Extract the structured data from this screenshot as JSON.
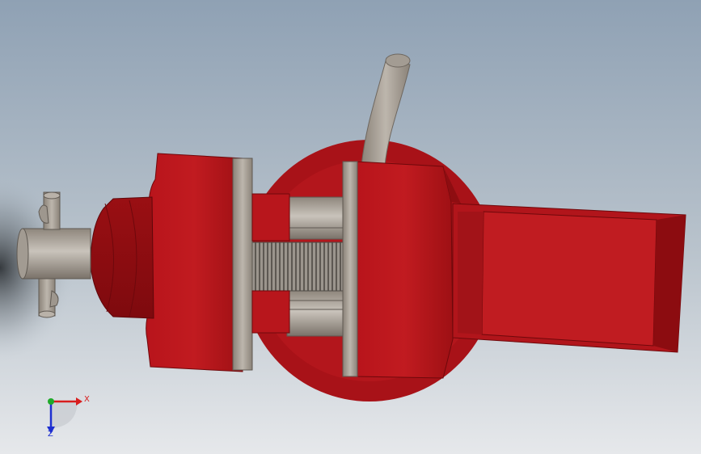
{
  "viewport": {
    "background_top": "#8ea0b3",
    "background_bottom": "#e4e7ea",
    "part_color": "#b5141a",
    "metal_color": "#9c948a"
  },
  "triad": {
    "x_label": "X",
    "z_label": "Z",
    "x_color": "#d81e1e",
    "z_color": "#1e2fd0",
    "y_color": "#1faa2a"
  }
}
